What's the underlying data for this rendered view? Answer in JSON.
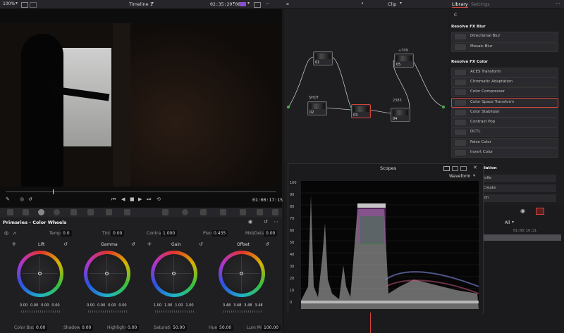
{
  "topbar": {
    "zoom": "100%",
    "timeline": "Timeline 1",
    "timecode": "02:35:29:08",
    "clip_label": "Clip",
    "tab_library": "Library",
    "tab_settings": "Settings"
  },
  "viewer": {
    "timecode": "01:00:17:15"
  },
  "nodes": {
    "n01": "01",
    "n02": "02",
    "n03": "03",
    "n04": "04",
    "n05": "05",
    "lbl_2383": "2383",
    "lbl_709": "+709",
    "lbl_shot": "SHOT"
  },
  "library": {
    "search": "C",
    "section_blur": "Resolve FX Blur",
    "blur_items": [
      "Directional Blur",
      "Mosaic Blur"
    ],
    "section_color": "Resolve FX Color",
    "color_items": [
      "ACES Transform",
      "Chromatic Adaptation",
      "Color Compressor",
      "Color Space Transform",
      "Color Stabilizer",
      "Contrast Pop",
      "DCTL",
      "False Color",
      "Invert Color"
    ],
    "partial_items": [
      "ulation",
      "rolle",
      "Create",
      "ion"
    ]
  },
  "scopes": {
    "title": "Scopes",
    "mode": "Waveform",
    "scale": [
      "100",
      "90",
      "80",
      "70",
      "60",
      "50",
      "40",
      "30",
      "20",
      "10",
      "0"
    ]
  },
  "timeline_panel": {
    "filter": "All",
    "tc": "01:00:10:21"
  },
  "primaries": {
    "title": "Primaries - Color Wheels",
    "temp_label": "Temp",
    "temp": "0.0",
    "tint_label": "Tint",
    "tint": "0.00",
    "contrast_label": "Contrast",
    "contrast": "1.000",
    "pivot_label": "Pivot",
    "pivot": "0.435",
    "middetail_label": "Mid/Detail",
    "middetail": "0.00",
    "wheels": [
      {
        "name": "Lift",
        "vals": [
          "0.00",
          "0.00",
          "0.00",
          "0.00"
        ]
      },
      {
        "name": "Gamma",
        "vals": [
          "0.00",
          "0.00",
          "0.00",
          "0.00"
        ]
      },
      {
        "name": "Gain",
        "vals": [
          "1.00",
          "1.00",
          "1.00",
          "1.00"
        ]
      },
      {
        "name": "Offset",
        "vals": [
          "3.48",
          "3.48",
          "3.48",
          "3.48"
        ]
      }
    ],
    "colorboost_label": "Color Boost",
    "colorboost": "0.00",
    "shadows_label": "Shadows",
    "shadows": "0.00",
    "highlights_label": "Highlights",
    "highlights": "0.00",
    "saturation_label": "Saturation",
    "saturation": "50.00",
    "hue_label": "Hue",
    "hue": "50.00",
    "lummix_label": "Lum Mix",
    "lummix": "100.00"
  },
  "colors": {
    "accent": "#d4453c",
    "panel": "#1f1f22"
  }
}
